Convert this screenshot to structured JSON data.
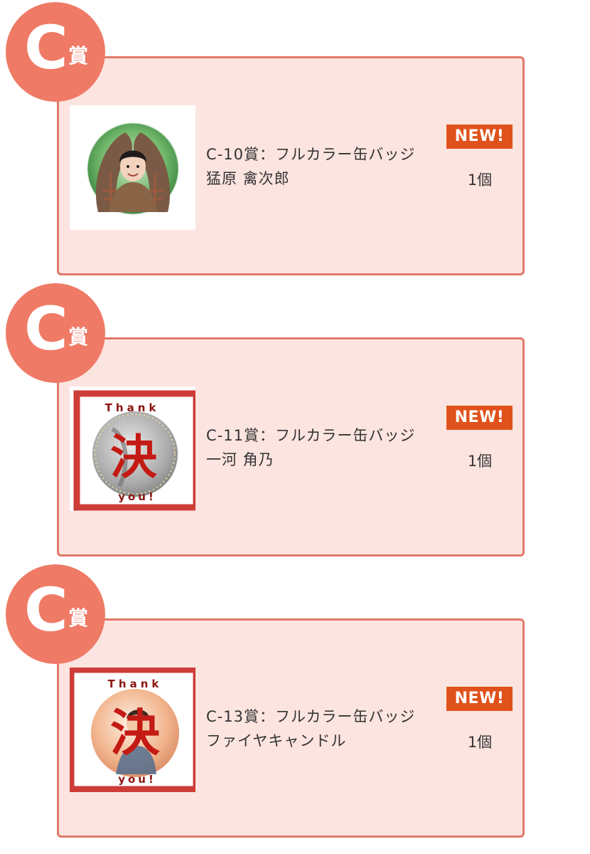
{
  "prizes": [
    {
      "grade_letter": "C",
      "grade_suffix": "賞",
      "name": "C-10賞：フルカラー缶バッジ 猛原 禽次郎",
      "badge": "NEW!",
      "quantity": "1個",
      "image_type": "photo-badge"
    },
    {
      "grade_letter": "C",
      "grade_suffix": "賞",
      "name": "C-11賞：フルカラー缶バッジ 一河 角乃",
      "badge": "NEW!",
      "quantity": "1個",
      "image_type": "decided-overlay",
      "overlay_text_top": "Thank",
      "overlay_text_center": "決",
      "overlay_text_bottom": "you!"
    },
    {
      "grade_letter": "C",
      "grade_suffix": "賞",
      "name": "C-13賞：フルカラー缶バッジ ファイヤキャンドル",
      "badge": "NEW!",
      "quantity": "1個",
      "image_type": "decided-overlay",
      "overlay_text_top": "Thank",
      "overlay_text_center": "決",
      "overlay_text_bottom": "you!"
    }
  ],
  "colors": {
    "grade_circle": "#ef7a66",
    "card_background": "#fce4e0",
    "card_border": "#e2796a",
    "new_badge": "#e0521b",
    "overlay_red": "#c41a14"
  }
}
